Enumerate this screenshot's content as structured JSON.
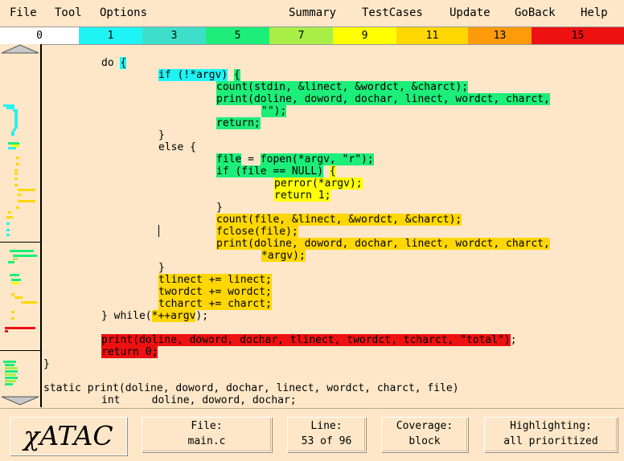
{
  "menu": {
    "left": [
      "File",
      "Tool",
      "Options"
    ],
    "right": [
      "Summary",
      "TestCases",
      "Update",
      "GoBack",
      "Help"
    ]
  },
  "legend": [
    {
      "label": "0",
      "color": "#ffffff"
    },
    {
      "label": "1",
      "color": "#1ff4f4"
    },
    {
      "label": "3",
      "color": "#3ddfcb"
    },
    {
      "label": "5",
      "color": "#1dee7a"
    },
    {
      "label": "7",
      "color": "#a8ee47"
    },
    {
      "label": "9",
      "color": "#ffff00"
    },
    {
      "label": "11",
      "color": "#ffd700"
    },
    {
      "label": "13",
      "color": "#ff9a08"
    },
    {
      "label": "15",
      "color": "#ee1111"
    }
  ],
  "code_lines": [
    {
      "indent": 9,
      "segs": [
        {
          "t": "do "
        },
        {
          "t": "{",
          "c": "#1ff4f4"
        }
      ]
    },
    {
      "indent": 18,
      "segs": [
        {
          "t": "if (!*argv)",
          "c": "#1ff4f4"
        },
        {
          "t": " "
        },
        {
          "t": "{",
          "c": "#1dee7a"
        }
      ]
    },
    {
      "indent": 27,
      "segs": [
        {
          "t": "count(stdin, &linect, &wordct, &charct);",
          "c": "#1dee7a"
        }
      ]
    },
    {
      "indent": 27,
      "segs": [
        {
          "t": "print(doline, doword, dochar, linect, wordct, charct,",
          "c": "#1dee7a"
        }
      ]
    },
    {
      "indent": 34,
      "segs": [
        {
          "t": "\"\");",
          "c": "#1dee7a"
        }
      ]
    },
    {
      "indent": 27,
      "segs": [
        {
          "t": "return;",
          "c": "#1dee7a"
        }
      ]
    },
    {
      "indent": 18,
      "segs": [
        {
          "t": "}"
        }
      ]
    },
    {
      "indent": 18,
      "segs": [
        {
          "t": "else {"
        }
      ]
    },
    {
      "indent": 27,
      "segs": [
        {
          "t": "file",
          "c": "#1dee7a"
        },
        {
          "t": " = "
        },
        {
          "t": "fopen(*argv, \"r\");",
          "c": "#1dee7a"
        }
      ]
    },
    {
      "indent": 27,
      "segs": [
        {
          "t": "if (file == NULL)",
          "c": "#1dee7a"
        },
        {
          "t": " "
        },
        {
          "t": "{",
          "c": "#ffff00"
        }
      ]
    },
    {
      "indent": 36,
      "segs": [
        {
          "t": "perror(*argv);",
          "c": "#ffff00"
        }
      ]
    },
    {
      "indent": 36,
      "segs": [
        {
          "t": "return 1;",
          "c": "#ffff00"
        }
      ]
    },
    {
      "indent": 27,
      "segs": [
        {
          "t": "}"
        }
      ]
    },
    {
      "indent": 27,
      "segs": [
        {
          "t": "count(file, &linect, &wordct, &charct);",
          "c": "#ffd700"
        }
      ]
    },
    {
      "indent": 27,
      "segs": [
        {
          "t": "fclose(file);",
          "c": "#ffd700"
        }
      ]
    },
    {
      "indent": 27,
      "segs": [
        {
          "t": "print(doline, doword, dochar, linect, wordct, charct,",
          "c": "#ffd700"
        }
      ]
    },
    {
      "indent": 34,
      "segs": [
        {
          "t": "*argv);",
          "c": "#ffd700"
        }
      ]
    },
    {
      "indent": 18,
      "segs": [
        {
          "t": "}"
        }
      ]
    },
    {
      "indent": 18,
      "segs": [
        {
          "t": "tlinect += linect;",
          "c": "#ffd700"
        }
      ]
    },
    {
      "indent": 18,
      "segs": [
        {
          "t": "twordct += wordct;",
          "c": "#ffd700"
        }
      ]
    },
    {
      "indent": 18,
      "segs": [
        {
          "t": "tcharct += charct;",
          "c": "#ffd700"
        }
      ]
    },
    {
      "indent": 9,
      "segs": [
        {
          "t": "} while("
        },
        {
          "t": "*++argv",
          "c": "#ffd700"
        },
        {
          "t": ");"
        }
      ]
    },
    {
      "indent": 0,
      "segs": []
    },
    {
      "indent": 9,
      "segs": [
        {
          "t": "print(doline, doword, dochar, tlinect, twordct, tcharct, \"total\")",
          "c": "#ee1111"
        },
        {
          "t": ";"
        }
      ]
    },
    {
      "indent": 9,
      "segs": [
        {
          "t": "return 0;",
          "c": "#ee1111"
        }
      ]
    },
    {
      "indent": 0,
      "segs": [
        {
          "t": "}"
        }
      ]
    },
    {
      "indent": 0,
      "segs": []
    },
    {
      "indent": 0,
      "segs": [
        {
          "t": "static print(doline, doword, dochar, linect, wordct, charct, file)"
        }
      ]
    },
    {
      "indent": 9,
      "segs": [
        {
          "t": "int     doline, doword, dochar;"
        }
      ]
    }
  ],
  "status": {
    "logo": "χATAC",
    "file_label": "File:",
    "file_value": "main.c",
    "line_label": "Line:",
    "line_value": "53 of 96",
    "coverage_label": "Coverage:",
    "coverage_value": "block",
    "highlight_label": "Highlighting:",
    "highlight_value": "all prioritized"
  }
}
